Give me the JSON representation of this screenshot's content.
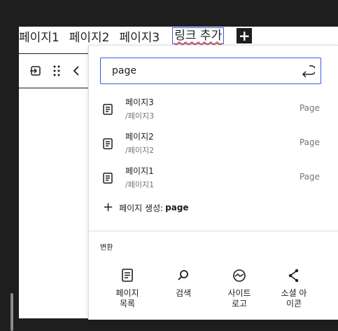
{
  "nav": {
    "items": [
      "페이지1",
      "페이지2",
      "페이지3"
    ],
    "link_add_label": "링크 추가",
    "plus_label": "+"
  },
  "search": {
    "value": "page"
  },
  "results": [
    {
      "title": "페이지3",
      "url": "/페이지3",
      "type": "Page"
    },
    {
      "title": "페이지2",
      "url": "/페이지2",
      "type": "Page"
    },
    {
      "title": "페이지1",
      "url": "/페이지1",
      "type": "Page"
    }
  ],
  "create": {
    "label": "페이지 생성: ",
    "query": "page"
  },
  "transform": {
    "label": "변환",
    "items": [
      {
        "label": "페이지\n목록",
        "icon": "page-list-icon"
      },
      {
        "label": "검색",
        "icon": "search-icon"
      },
      {
        "label": "사이트\n로고",
        "icon": "site-logo-icon"
      },
      {
        "label": "소셜 아\n이콘",
        "icon": "share-icon"
      }
    ]
  },
  "colors": {
    "accent": "#3858e9",
    "text": "#1e1e1e",
    "muted": "#757575",
    "frame": "#1e1e1e"
  }
}
